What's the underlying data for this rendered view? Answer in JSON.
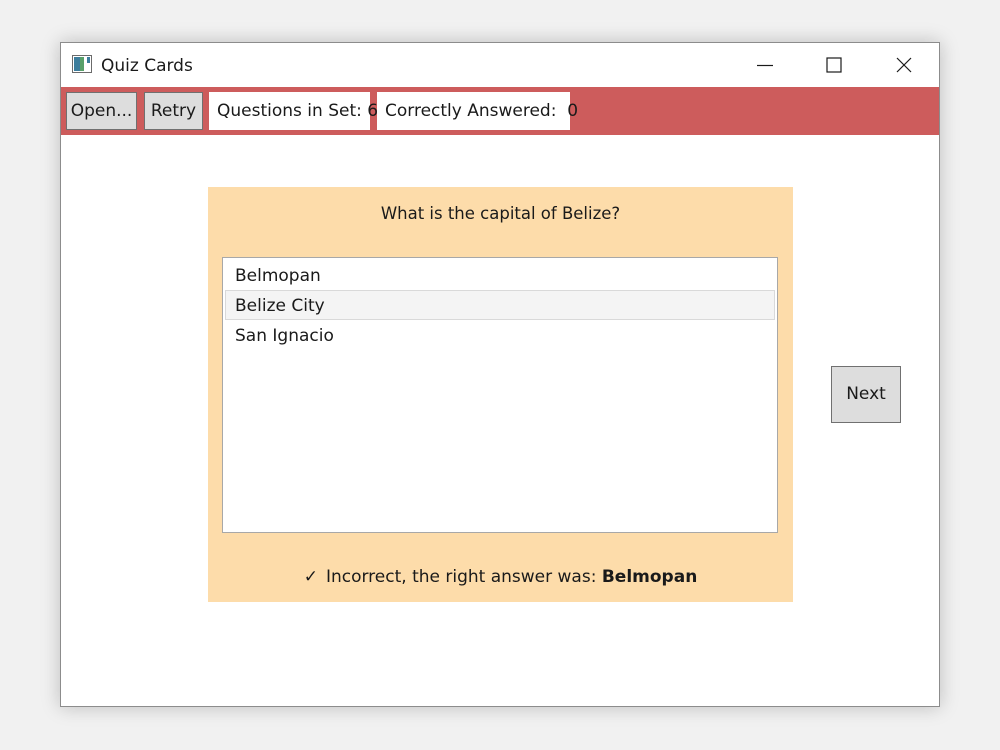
{
  "window": {
    "title": "Quiz Cards",
    "app_icon": "quiz-cards-app-icon",
    "controls": [
      "minimize-icon",
      "maximize-icon",
      "close-icon"
    ]
  },
  "toolbar": {
    "open_label": "Open...",
    "retry_label": "Retry",
    "questions_in_set_label": "Questions in Set: 6",
    "correctly_answered_label": "Correctly Answered:  0",
    "background_color": "#cd5c5c"
  },
  "card": {
    "question": "What is the capital of Belize?",
    "answers": [
      "Belmopan",
      "Belize City",
      "San Ignacio"
    ],
    "selected_answer": "Belize City",
    "feedback_icon": "✓",
    "feedback_prefix": "Incorrect, the right answer was:",
    "feedback_answer": "Belmopan",
    "background_color": "#fddcaa"
  },
  "next_label": "Next"
}
